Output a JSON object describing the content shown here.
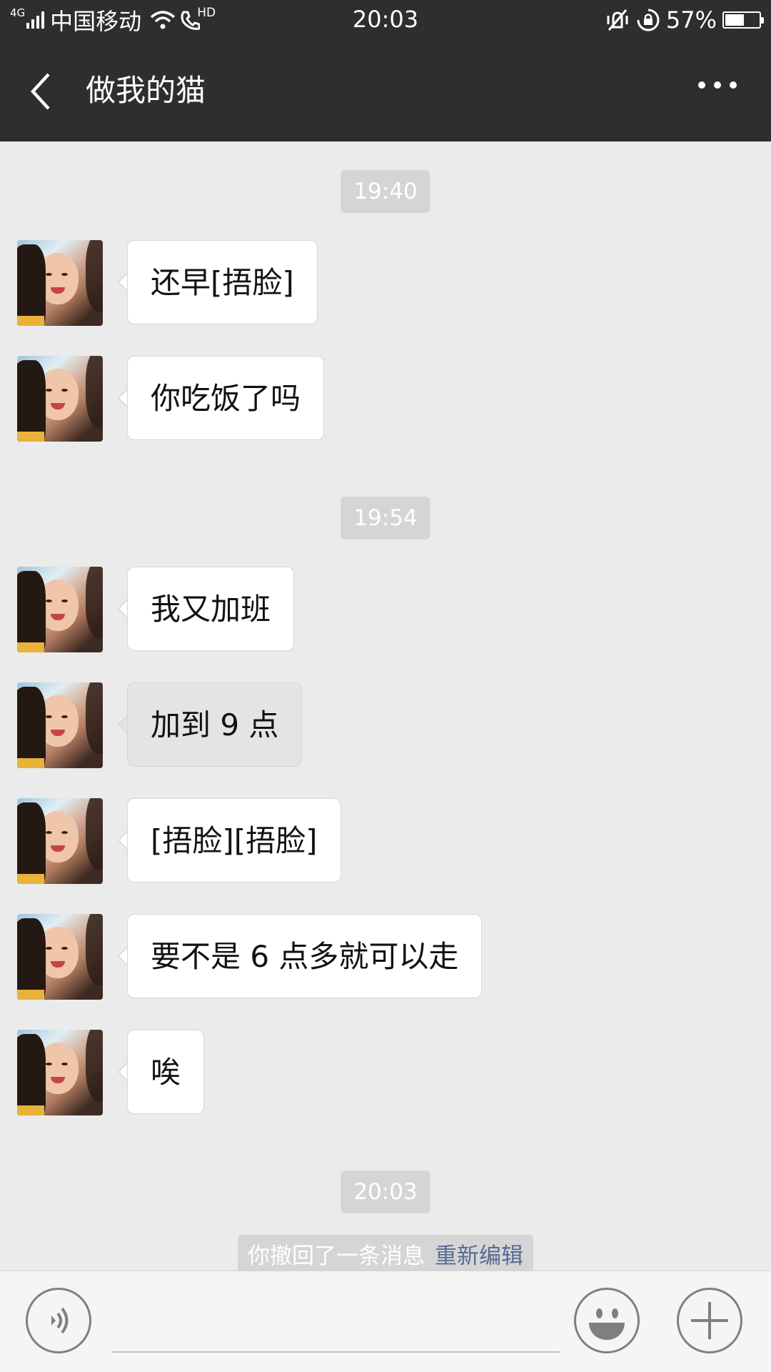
{
  "status_bar": {
    "network_type": "4G",
    "carrier": "中国移动",
    "hd_label": "HD",
    "time": "20:03",
    "battery_percent": "57%",
    "battery_level": 0.57,
    "icons": [
      "signal-icon",
      "wifi-icon",
      "hd-call-icon",
      "vibrate-icon",
      "rotation-lock-icon",
      "battery-icon"
    ]
  },
  "header": {
    "title": "做我的猫",
    "back_icon": "chevron-left-icon",
    "more_icon": "more-dots-icon"
  },
  "chat": {
    "timestamps": [
      "19:40",
      "19:54",
      "20:03"
    ],
    "messages": [
      {
        "text": "还早[捂脸]"
      },
      {
        "text": "你吃饭了吗"
      },
      {
        "text": "我又加班"
      },
      {
        "text": "加到 9 点"
      },
      {
        "text": "[捂脸][捂脸]"
      },
      {
        "text": "要不是 6 点多就可以走"
      },
      {
        "text": "唉"
      }
    ],
    "recall_notice": {
      "text": "你撤回了一条消息",
      "link": "重新编辑"
    }
  },
  "input_bar": {
    "voice_icon": "voice-icon",
    "emoji_icon": "emoji-icon",
    "plus_icon": "plus-icon",
    "input_value": ""
  },
  "colors": {
    "header_bg": "#2e2e2e",
    "chat_bg": "#ebebeb",
    "bubble_bg": "#ffffff",
    "time_chip_bg": "#d5d5d5",
    "link": "#576b95"
  }
}
